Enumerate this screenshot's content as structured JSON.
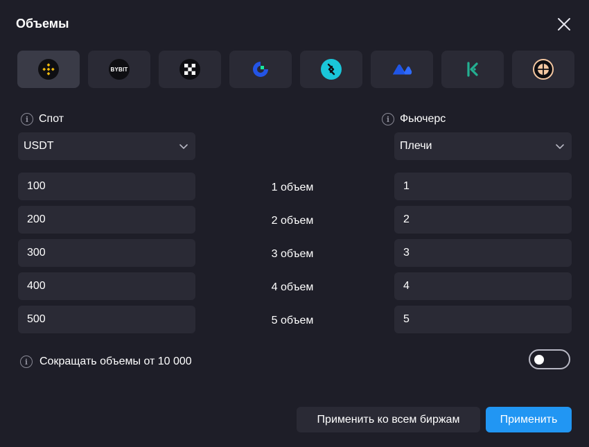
{
  "dialog": {
    "title": "Объемы"
  },
  "exchanges": [
    {
      "name": "Binance",
      "icon": "binance-icon",
      "active": true,
      "color": "#f0b90b"
    },
    {
      "name": "Bybit",
      "icon": "bybit-icon",
      "active": false,
      "label": "BYBIT"
    },
    {
      "name": "OKX",
      "icon": "okx-icon",
      "active": false
    },
    {
      "name": "Gate",
      "icon": "gate-icon",
      "active": false,
      "color": "#2354e6"
    },
    {
      "name": "Bitget",
      "icon": "bitget-icon",
      "active": false,
      "color": "#1ac6d9"
    },
    {
      "name": "MEXC",
      "icon": "mexc-icon",
      "active": false,
      "color": "#2f6bff"
    },
    {
      "name": "KuCoin",
      "icon": "kucoin-icon",
      "active": false,
      "color": "#23af91"
    },
    {
      "name": "Other",
      "icon": "compass-icon",
      "active": false,
      "color": "#f4c7a1"
    }
  ],
  "spot": {
    "label": "Спот",
    "currency": "USDT",
    "values": [
      "100",
      "200",
      "300",
      "400",
      "500"
    ]
  },
  "futures": {
    "label": "Фьючерс",
    "mode": "Плечи",
    "values": [
      "1",
      "2",
      "3",
      "4",
      "5"
    ]
  },
  "volume_labels": [
    "1 объем",
    "2 объем",
    "3 объем",
    "4 объем",
    "5 объем"
  ],
  "reduce": {
    "label": "Сокращать объемы от 10 000",
    "enabled": false
  },
  "buttons": {
    "apply_all": "Применить ко всем биржам",
    "apply": "Применить"
  },
  "colors": {
    "accent": "#2196f3",
    "panel": "#1e1e28",
    "field": "#2a2a35"
  }
}
